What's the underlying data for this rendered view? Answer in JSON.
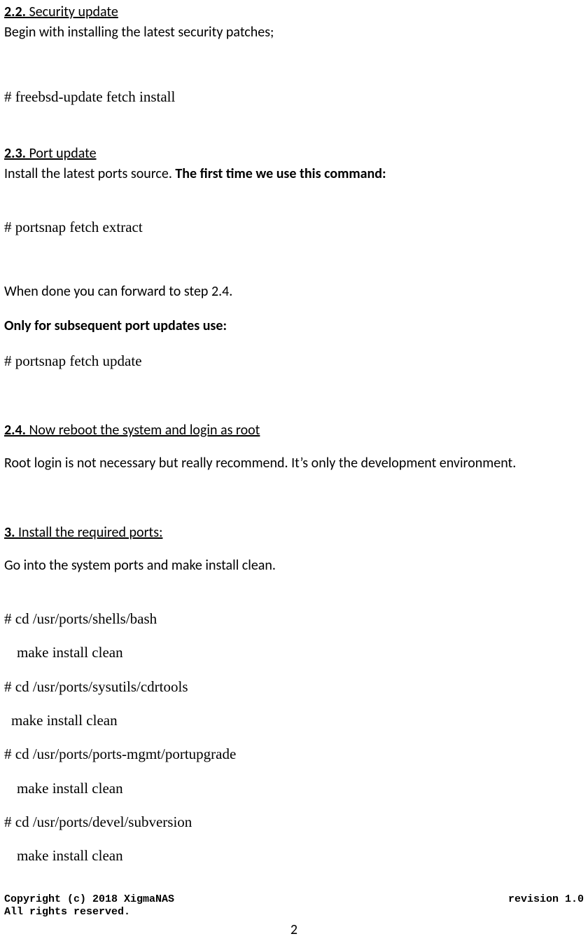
{
  "sections": {
    "s22": {
      "num": "2.2.",
      "title": "Security update"
    },
    "s22_body": "Begin with installing the latest security patches;",
    "cmd22": "# freebsd-update fetch install",
    "s23": {
      "num": "2.3.",
      "title": "Port update"
    },
    "s23_body_a": "Install the latest ports source.  ",
    "s23_body_b": "The first time we use this command:",
    "cmd23a": "# portsnap fetch extract",
    "s23_after": "When done you can forward to step 2.4.",
    "s23_only": "Only for subsequent port updates use:",
    "cmd23b": "# portsnap fetch update",
    "s24": {
      "num": "2.4.",
      "title": "Now reboot the system and login as root"
    },
    "s24_body": "Root login is not necessary but really recommend. It’s only the development environment.",
    "s3": {
      "num": "3.",
      "title": "Install the required ports:"
    },
    "s3_body": "Go into the system ports and make install clean.",
    "cmds3": [
      "# cd /usr/ports/shells/bash",
      "make install clean",
      "# cd /usr/ports/sysutils/cdrtools",
      "make install clean",
      "# cd /usr/ports/ports-mgmt/portupgrade",
      "make install clean",
      "# cd /usr/ports/devel/subversion",
      "make install clean"
    ]
  },
  "footer": {
    "left_line1": "Copyright (c) 2018 XigmaNAS",
    "left_line2": "All rights reserved.",
    "right": "revision 1.0"
  },
  "page_number": "2"
}
